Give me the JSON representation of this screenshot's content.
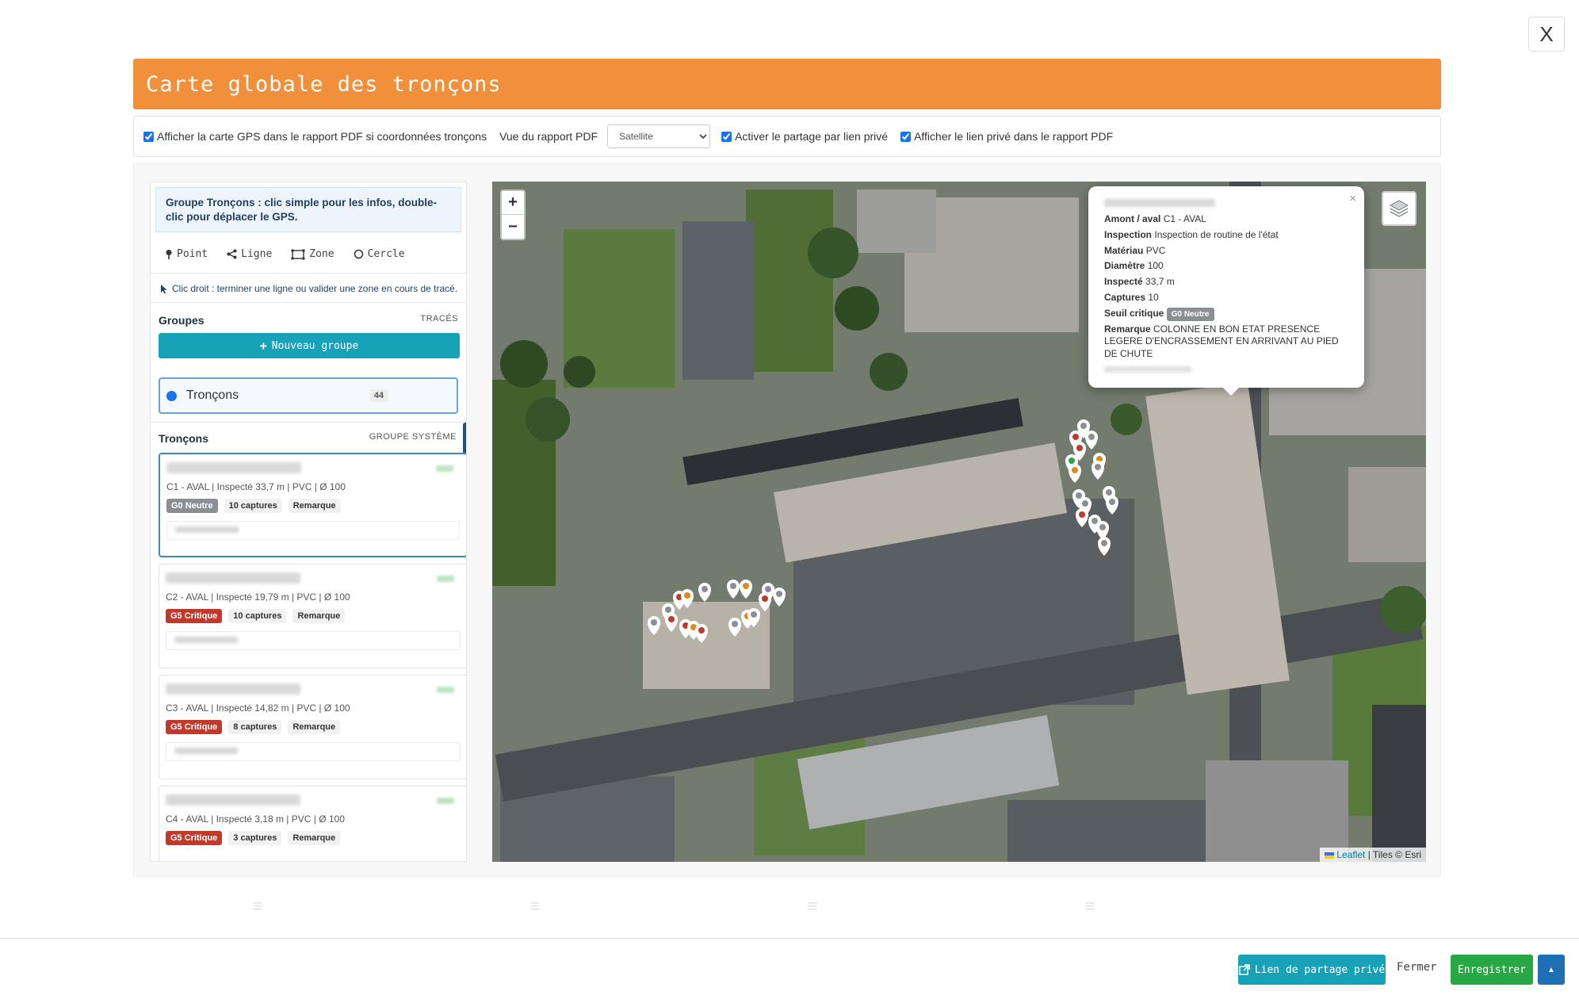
{
  "window": {
    "close_label": "X"
  },
  "header": {
    "title": "Carte globale des tronçons"
  },
  "options": {
    "show_gps_label": "Afficher la carte GPS dans le rapport PDF si coordonnées tronçons",
    "pdf_view_label": "Vue du rapport PDF",
    "pdf_view_value": "Satellite",
    "share_label": "Activer le partage par lien privé",
    "show_link_label": "Afficher le lien privé dans le rapport PDF"
  },
  "sidebar": {
    "intro": "Groupe Tronçons : clic simple pour les infos, double-clic pour déplacer le GPS.",
    "tools": [
      {
        "icon": "pin-icon",
        "label": "Point"
      },
      {
        "icon": "share-icon",
        "label": "Ligne"
      },
      {
        "icon": "area-icon",
        "label": "Zone"
      },
      {
        "icon": "circle-icon",
        "label": "Cercle"
      }
    ],
    "hint": "Clic droit : terminer une ligne ou valider une zone en cours de tracé.",
    "groups_title": "Groupes",
    "groups_subtitle": "TRACÉS",
    "new_group_label": "Nouveau groupe",
    "group": {
      "name": "Tronçons",
      "count": "44"
    },
    "list_title": "Tronçons",
    "list_subtitle": "GROUPE SYSTÈME",
    "items": [
      {
        "meta": "C1 - AVAL | Inspecté 33,7 m | PVC | Ø 100",
        "status": "G0 Neutre",
        "status_kind": "neutral",
        "captures": "10 captures",
        "remark": "Remarque"
      },
      {
        "meta": "C2 - AVAL | Inspecté 19,79 m | PVC | Ø 100",
        "status": "G5 Critique",
        "status_kind": "critical",
        "captures": "10 captures",
        "remark": "Remarque"
      },
      {
        "meta": "C3 - AVAL | Inspecté 14,82 m | PVC | Ø 100",
        "status": "G5 Critique",
        "status_kind": "critical",
        "captures": "8 captures",
        "remark": "Remarque"
      },
      {
        "meta": "C4 - AVAL | Inspecté 3,18 m | PVC | Ø 100",
        "status": "G5 Critique",
        "status_kind": "critical",
        "captures": "3 captures",
        "remark": "Remarque"
      }
    ]
  },
  "map": {
    "zoom_in": "+",
    "zoom_out": "−",
    "attribution_leaflet": "Leaflet",
    "attribution_tiles": "| Tiles © Esri",
    "popup": {
      "close": "×",
      "amont_label": "Amont / aval",
      "amont_value": "C1 - AVAL",
      "inspection_label": "Inspection",
      "inspection_value": "Inspection de routine de l'état",
      "material_label": "Matériau",
      "material_value": "PVC",
      "diameter_label": "Diamètre",
      "diameter_value": "100",
      "inspected_label": "Inspecté",
      "inspected_value": "33,7 m",
      "captures_label": "Captures",
      "captures_value": "10",
      "threshold_label": "Seuil critique",
      "threshold_value": "G0 Neutre",
      "remark_label": "Remarque",
      "remark_value": "COLONNE EN BON ETAT PRESENCE LEGERE D'ENCRASSEMENT EN ARRIVANT AU PIED DE CHUTE"
    }
  },
  "footer": {
    "share_button": "Lien de partage privé",
    "close_button": "Fermer",
    "save_button": "Enregistrer"
  },
  "colors": {
    "header": "#f28f3b",
    "teal": "#17a2b8",
    "green": "#28a745",
    "critical": "#c0392b",
    "neutral": "#8b8f93"
  }
}
